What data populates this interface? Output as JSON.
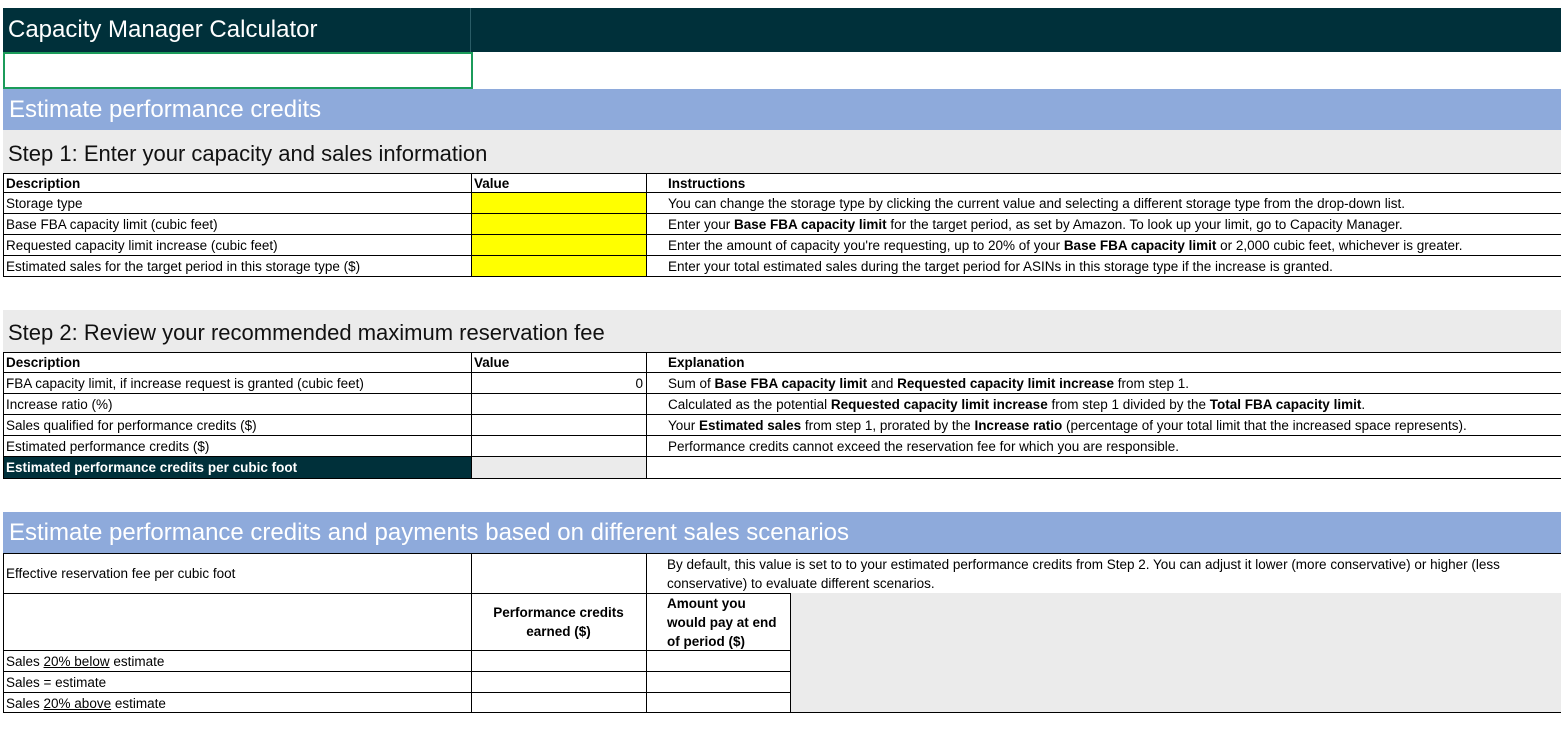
{
  "title": "Capacity Manager Calculator",
  "section1": "Estimate performance credits",
  "step1": {
    "title": "Step 1: Enter your capacity and sales information",
    "col_description": "Description",
    "col_value": "Value",
    "col_instructions": "Instructions",
    "rows": [
      {
        "description": "Storage type",
        "instr": "You can change the storage type by clicking the current value and selecting a different storage type from the drop-down list."
      },
      {
        "description": "Base FBA capacity limit (cubic feet)",
        "instr_a": "Enter your ",
        "instr_b": "Base FBA capacity limit",
        "instr_c": " for the target period, as set by Amazon. To look up your limit, go to Capacity Manager."
      },
      {
        "description": "Requested capacity limit increase (cubic feet)",
        "instr_a": "Enter the amount of capacity you're requesting, up to 20% of your ",
        "instr_b": "Base FBA capacity limit",
        "instr_c": " or 2,000 cubic feet, whichever is greater."
      },
      {
        "description": "Estimated sales for the target period in this storage type ($)",
        "instr": "Enter your total estimated sales during the target period for ASINs in this storage type if the increase is granted."
      }
    ]
  },
  "step2": {
    "title": "Step 2: Review your recommended maximum reservation fee",
    "col_description": "Description",
    "col_value": "Value",
    "col_explanation": "Explanation",
    "rows": [
      {
        "description": "FBA capacity limit, if increase request is granted (cubic feet)",
        "value": "0",
        "e1": "Sum of ",
        "e2": "Base FBA capacity limit",
        "e3": " and ",
        "e4": "Requested capacity limit increase",
        "e5": " from step 1."
      },
      {
        "description": "Increase ratio (%)",
        "value": "",
        "e1": "Calculated as the potential ",
        "e2": "Requested capacity limit increase",
        "e3": " from step 1 divided by the ",
        "e4": "Total FBA capacity limit",
        "e5": "."
      },
      {
        "description": "Sales qualified for performance credits ($)",
        "value": "",
        "e1": "Your ",
        "e2": "Estimated sales",
        "e3": " from step 1, prorated by the ",
        "e4": "Increase ratio",
        "e5": " (percentage of your total limit that the increased space represents)."
      },
      {
        "description": "Estimated performance credits ($)",
        "value": "",
        "e1": "Performance credits cannot exceed the reservation fee for which you are responsible.",
        "e2": "",
        "e3": "",
        "e4": "",
        "e5": ""
      }
    ],
    "highlight_label": "Estimated performance credits per cubic foot"
  },
  "section2": "Estimate performance credits and payments based on different sales scenarios",
  "scenarios": {
    "effective_fee_label": "Effective reservation fee per cubic foot",
    "effective_fee_note": "By default, this value is set to to your estimated performance credits from Step 2. You can adjust it lower (more conservative) or higher (less conservative) to evaluate different scenarios.",
    "col_perf_line1": "Performance credits",
    "col_perf_line2": "earned ($)",
    "col_amount_line1": "Amount you",
    "col_amount_line2": "would pay at end",
    "col_amount_line3": "of period ($)",
    "rows": [
      {
        "a": "Sales ",
        "u": "20% below",
        "b": " estimate"
      },
      {
        "a": "Sales = estimate",
        "u": "",
        "b": ""
      },
      {
        "a": "Sales ",
        "u": "20% above",
        "b": " estimate"
      }
    ]
  },
  "colors": {
    "title_band": "#00303a",
    "section_band": "#8eaadb",
    "step_band": "#ebebeb",
    "input_cell": "#ffff00",
    "selection": "#1b9b5a"
  }
}
